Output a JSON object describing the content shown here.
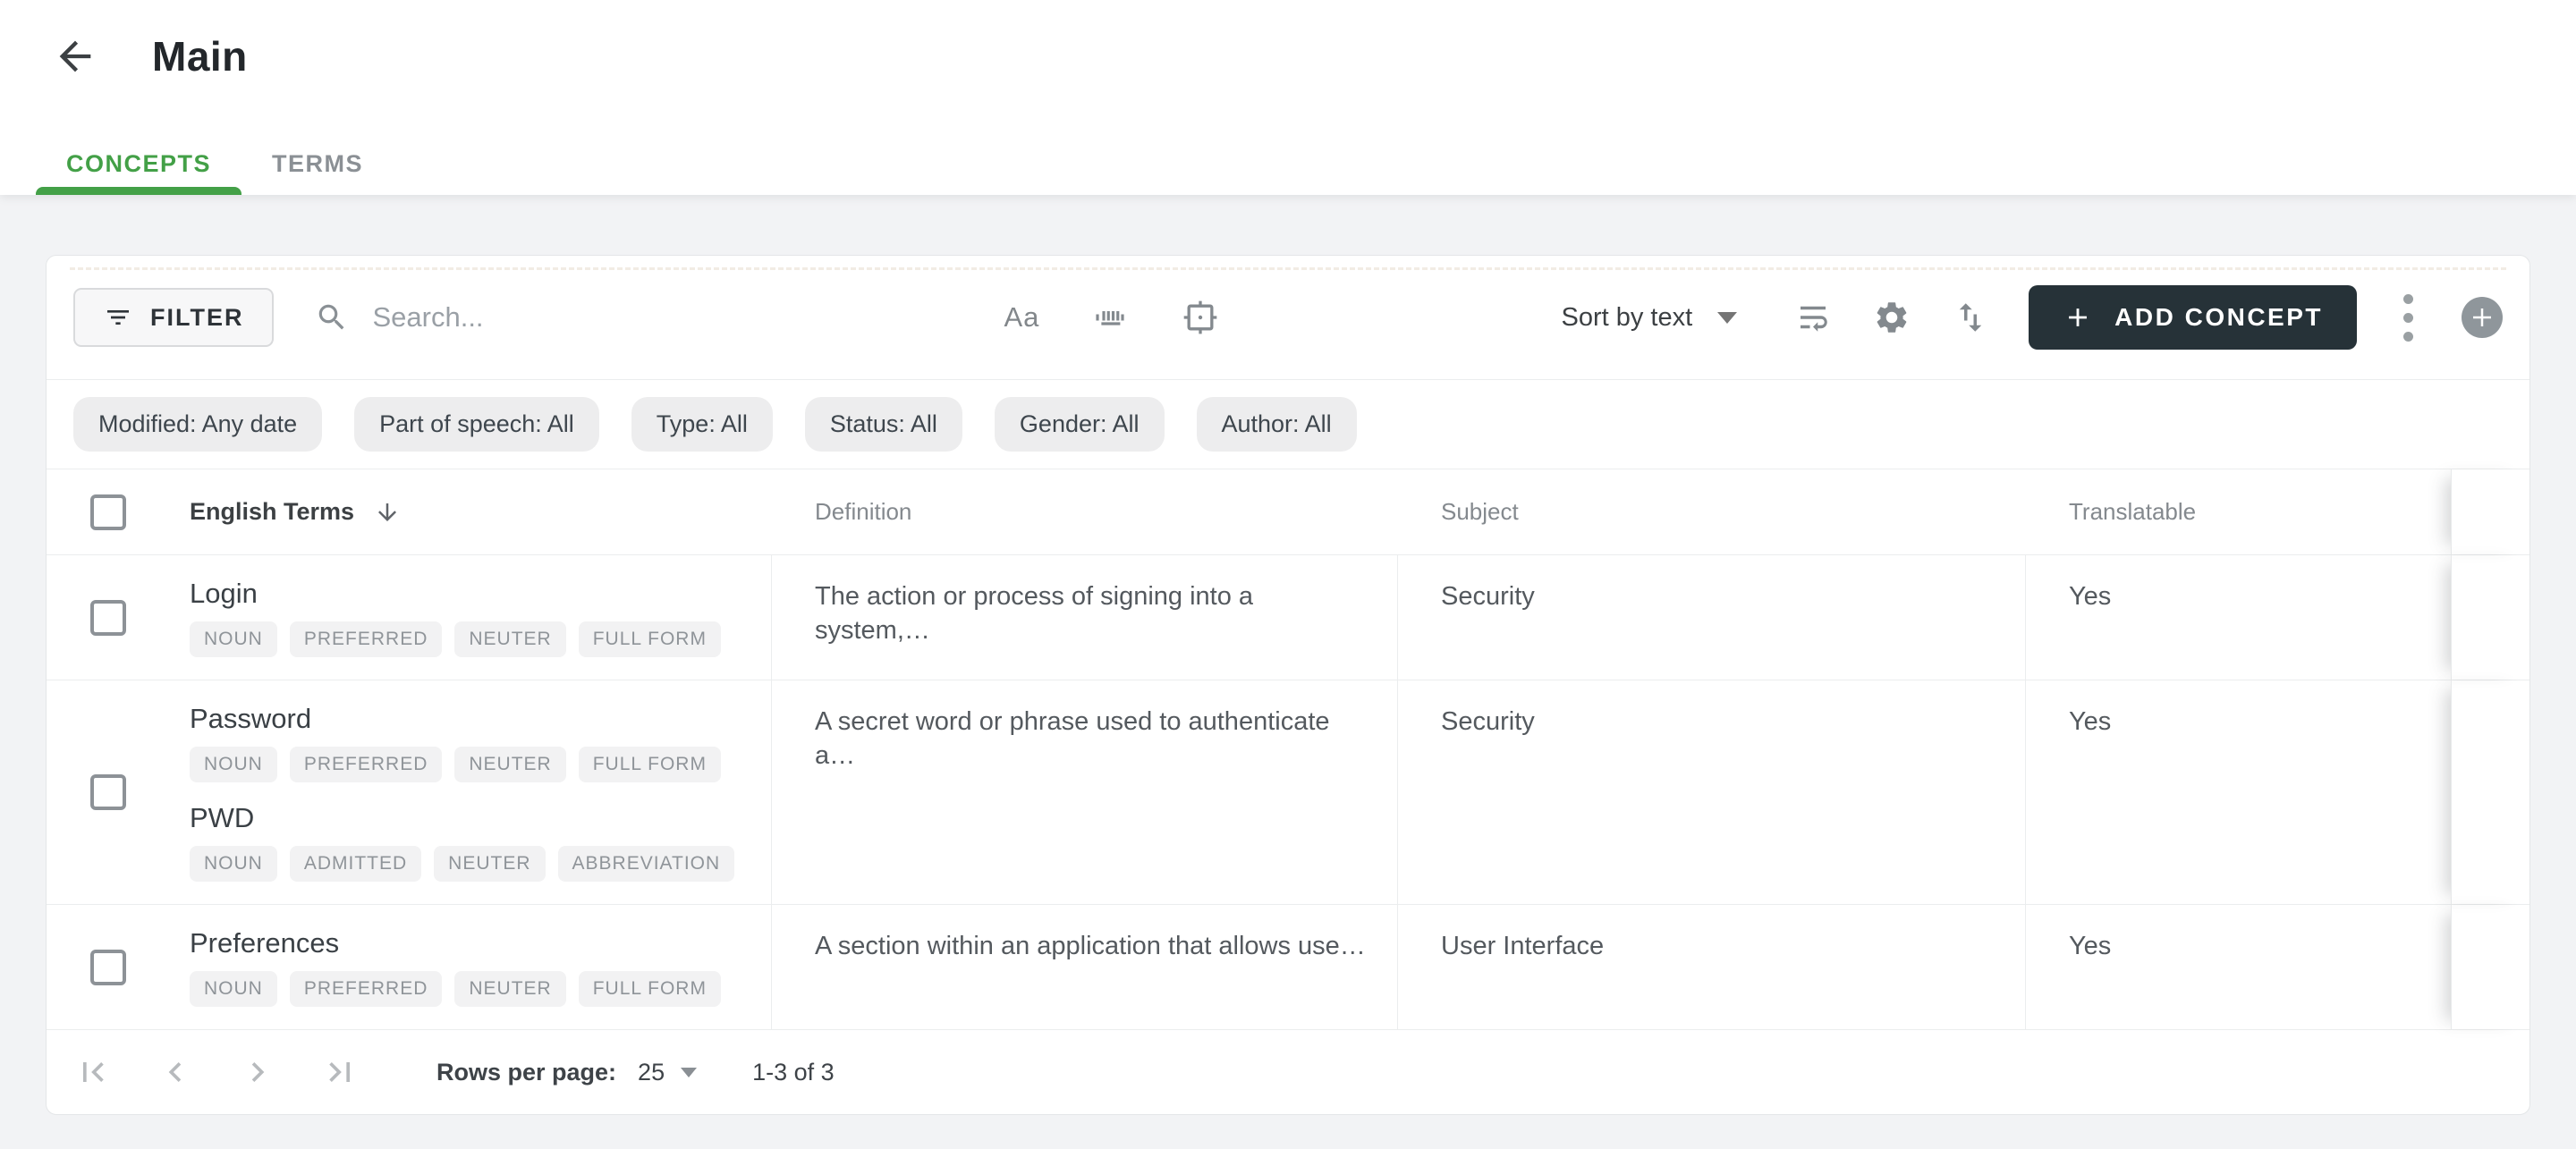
{
  "header": {
    "title": "Main"
  },
  "tabs": [
    {
      "label": "CONCEPTS",
      "active": true
    },
    {
      "label": "TERMS",
      "active": false
    }
  ],
  "toolbar": {
    "filter_label": "FILTER",
    "search_placeholder": "Search...",
    "search_value": "",
    "match_case_label": "Aa",
    "sort_label": "Sort by text",
    "add_button_label": "ADD CONCEPT"
  },
  "filters": [
    "Modified: Any date",
    "Part of speech: All",
    "Type: All",
    "Status: All",
    "Gender: All",
    "Author: All"
  ],
  "table": {
    "columns": [
      "English Terms",
      "Definition",
      "Subject",
      "Translatable"
    ],
    "rows": [
      {
        "terms": [
          {
            "text": "Login",
            "badges": [
              "NOUN",
              "PREFERRED",
              "NEUTER",
              "FULL FORM"
            ]
          }
        ],
        "definition": "The action or process of signing into a system,…",
        "subject": "Security",
        "translatable": "Yes"
      },
      {
        "terms": [
          {
            "text": "Password",
            "badges": [
              "NOUN",
              "PREFERRED",
              "NEUTER",
              "FULL FORM"
            ]
          },
          {
            "text": "PWD",
            "badges": [
              "NOUN",
              "ADMITTED",
              "NEUTER",
              "ABBREVIATION"
            ]
          }
        ],
        "definition": "A secret word or phrase used to authenticate a…",
        "subject": "Security",
        "translatable": "Yes"
      },
      {
        "terms": [
          {
            "text": "Preferences",
            "badges": [
              "NOUN",
              "PREFERRED",
              "NEUTER",
              "FULL FORM"
            ]
          }
        ],
        "definition": "A section within an application that allows use…",
        "subject": "User Interface",
        "translatable": "Yes"
      }
    ]
  },
  "pagination": {
    "rows_per_page_label": "Rows per page:",
    "rows_per_page_value": "25",
    "range_label": "1-3 of 3"
  },
  "colors": {
    "accent_green": "#43a047",
    "add_button_bg": "#263238",
    "page_bg": "#f2f3f5",
    "chip_bg": "#ededee",
    "badge_bg": "#f2f2f3"
  }
}
